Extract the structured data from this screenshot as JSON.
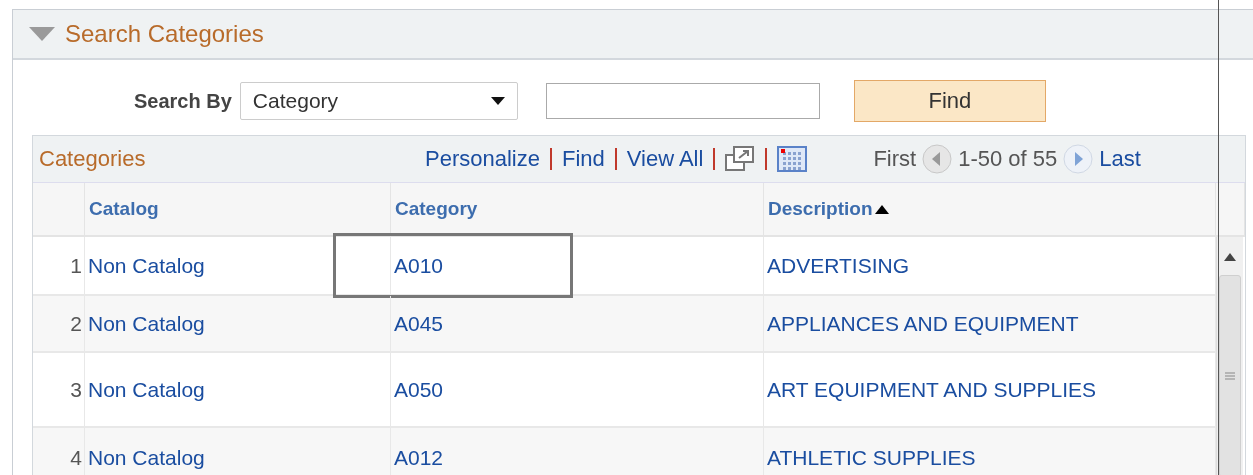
{
  "panel": {
    "title": "Search Categories",
    "expanded": true
  },
  "search": {
    "label": "Search By",
    "select_value": "Category",
    "find_button": "Find"
  },
  "grid": {
    "title": "Categories",
    "links": [
      "Personalize",
      "Find",
      "View All"
    ],
    "nav": {
      "first": "First",
      "range": "1-50 of 55",
      "last": "Last"
    },
    "columns": [
      {
        "label": "Catalog"
      },
      {
        "label": "Category"
      },
      {
        "label": "Description",
        "sorted_ascending": true
      }
    ],
    "rows": [
      {
        "number": "1",
        "catalog": "Non Catalog",
        "category": "A010",
        "description": "ADVERTISING",
        "highlighted": true
      },
      {
        "number": "2",
        "catalog": "Non Catalog",
        "category": "A045",
        "description": "APPLIANCES AND EQUIPMENT",
        "highlighted": false
      },
      {
        "number": "3",
        "catalog": "Non Catalog",
        "category": "A050",
        "description": "ART EQUIPMENT AND SUPPLIES",
        "highlighted": false
      },
      {
        "number": "4",
        "catalog": "Non Catalog",
        "category": "A012",
        "description": "ATHLETIC SUPPLIES",
        "highlighted": false
      }
    ]
  }
}
